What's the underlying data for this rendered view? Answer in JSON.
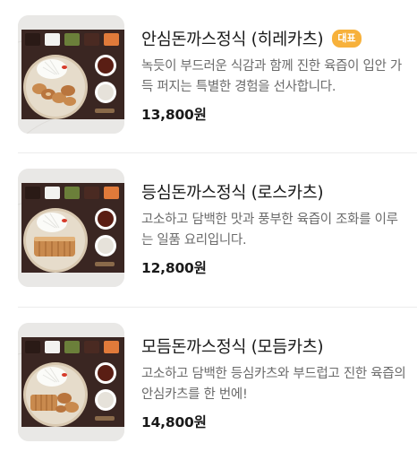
{
  "menu": {
    "items": [
      {
        "title": "안심돈까스정식 (히레카츠)",
        "badge": "대표",
        "description": "녹듯이 부드러운 식감과 함께 진한 육즙이 입안 가득 퍼지는 특별한 경험을 선사합니다.",
        "price": "13,800원",
        "image": "hire-katsu-set-photo"
      },
      {
        "title": "등심돈까스정식 (로스카츠)",
        "badge": "",
        "description": "고소하고 담백한 맛과 풍부한 육즙이 조화를 이루는 일품 요리입니다.",
        "price": "12,800원",
        "image": "rosu-katsu-set-photo"
      },
      {
        "title": "모듬돈까스정식 (모듬카츠)",
        "badge": "",
        "description": "고소하고 담백한 등심카츠와 부드럽고 진한 육즙의 안심카츠를 한 번에!",
        "price": "14,800원",
        "image": "mixed-katsu-set-photo"
      }
    ]
  },
  "colors": {
    "badge": "#f7b13b",
    "tray": "#3a2622",
    "marble": "#e9e8e6",
    "katsu": "#c98a4e"
  }
}
